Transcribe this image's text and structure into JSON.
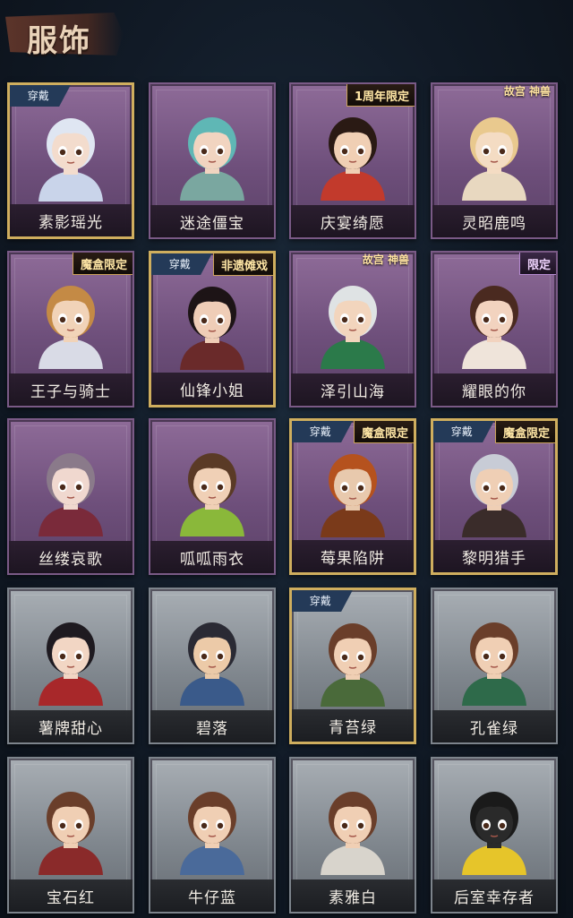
{
  "header": {
    "title": "服饰"
  },
  "equipped_label": "穿戴",
  "cards": [
    {
      "name": "素影瑶光",
      "theme": "purple",
      "equipped": true,
      "tag": "",
      "tag_style": "",
      "hair": "#dfe6f2",
      "skin": "#f3dccd",
      "outfit": "#c9d4ea"
    },
    {
      "name": "迷途僵宝",
      "theme": "purple",
      "equipped": false,
      "tag": "",
      "tag_style": "",
      "hair": "#5fb7b5",
      "skin": "#f1d4c0",
      "outfit": "#7aa7a0"
    },
    {
      "name": "庆宴绮愿",
      "theme": "purple",
      "equipped": false,
      "tag": "1周年限定",
      "tag_style": "gold",
      "hair": "#2a1a14",
      "skin": "#f0cfb4",
      "outfit": "#c23a2c"
    },
    {
      "name": "灵昭鹿鸣",
      "theme": "purple",
      "equipped": false,
      "tag": "故宫 神兽",
      "tag_style": "gugong",
      "hair": "#e9c98e",
      "skin": "#f4dcc3",
      "outfit": "#e8d8c0"
    },
    {
      "name": "王子与骑士",
      "theme": "purple",
      "equipped": false,
      "tag": "魔盒限定",
      "tag_style": "gold",
      "hair": "#c48a45",
      "skin": "#f1d3b8",
      "outfit": "#d9dbe6"
    },
    {
      "name": "仙锋小姐",
      "theme": "purple",
      "equipped": true,
      "tag": "非遗傩戏",
      "tag_style": "gold",
      "hair": "#1d1416",
      "skin": "#efcdb7",
      "outfit": "#6a2a2a"
    },
    {
      "name": "泽引山海",
      "theme": "purple",
      "equipped": false,
      "tag": "故宫 神兽",
      "tag_style": "gugong",
      "hair": "#dfe3e4",
      "skin": "#f2d5bd",
      "outfit": "#2b7a4a"
    },
    {
      "name": "耀眼的你",
      "theme": "purple",
      "equipped": false,
      "tag": "限定",
      "tag_style": "limit",
      "hair": "#4a2a20",
      "skin": "#f2d3bf",
      "outfit": "#efe4da"
    },
    {
      "name": "丝缕哀歌",
      "theme": "purple",
      "equipped": false,
      "tag": "",
      "tag_style": "",
      "hair": "#8a7a8a",
      "skin": "#f0d8cf",
      "outfit": "#7a2a3a"
    },
    {
      "name": "呱呱雨衣",
      "theme": "purple",
      "equipped": false,
      "tag": "",
      "tag_style": "",
      "hair": "#5a3a26",
      "skin": "#f0d0b6",
      "outfit": "#8ab83a"
    },
    {
      "name": "莓果陷阱",
      "theme": "purple",
      "equipped": true,
      "tag": "魔盒限定",
      "tag_style": "gold",
      "hair": "#b5521e",
      "skin": "#e8c9ad",
      "outfit": "#7a3a1a"
    },
    {
      "name": "黎明猎手",
      "theme": "purple",
      "equipped": true,
      "tag": "魔盒限定",
      "tag_style": "gold",
      "hair": "#c8ccd6",
      "skin": "#efcfb5",
      "outfit": "#3a2c2a"
    },
    {
      "name": "薯牌甜心",
      "theme": "gray",
      "equipped": false,
      "tag": "",
      "tag_style": "",
      "hair": "#1e1a20",
      "skin": "#f2d6c4",
      "outfit": "#a8282a"
    },
    {
      "name": "碧落",
      "theme": "gray",
      "equipped": false,
      "tag": "",
      "tag_style": "",
      "hair": "#2a2a34",
      "skin": "#eccaa8",
      "outfit": "#3a5a8a"
    },
    {
      "name": "青苔绿",
      "theme": "gray",
      "equipped": true,
      "tag": "",
      "tag_style": "",
      "hair": "#6a3e2a",
      "skin": "#f0cfb4",
      "outfit": "#4a6a3a"
    },
    {
      "name": "孔雀绿",
      "theme": "gray",
      "equipped": false,
      "tag": "",
      "tag_style": "",
      "hair": "#6a3e2a",
      "skin": "#f0cfb4",
      "outfit": "#2e6a4a"
    },
    {
      "name": "宝石红",
      "theme": "gray",
      "equipped": false,
      "tag": "",
      "tag_style": "",
      "hair": "#6a3e2a",
      "skin": "#f0cfb4",
      "outfit": "#8a2a2a"
    },
    {
      "name": "牛仔蓝",
      "theme": "gray",
      "equipped": false,
      "tag": "",
      "tag_style": "",
      "hair": "#6a3e2a",
      "skin": "#f0cfb4",
      "outfit": "#4a6a9a"
    },
    {
      "name": "素雅白",
      "theme": "gray",
      "equipped": false,
      "tag": "",
      "tag_style": "",
      "hair": "#6a3e2a",
      "skin": "#f0cfb4",
      "outfit": "#d8d4cc"
    },
    {
      "name": "后室幸存者",
      "theme": "gray",
      "equipped": false,
      "tag": "",
      "tag_style": "",
      "hair": "#1a1a1a",
      "skin": "#2a2a2a",
      "outfit": "#e6c52a"
    }
  ]
}
